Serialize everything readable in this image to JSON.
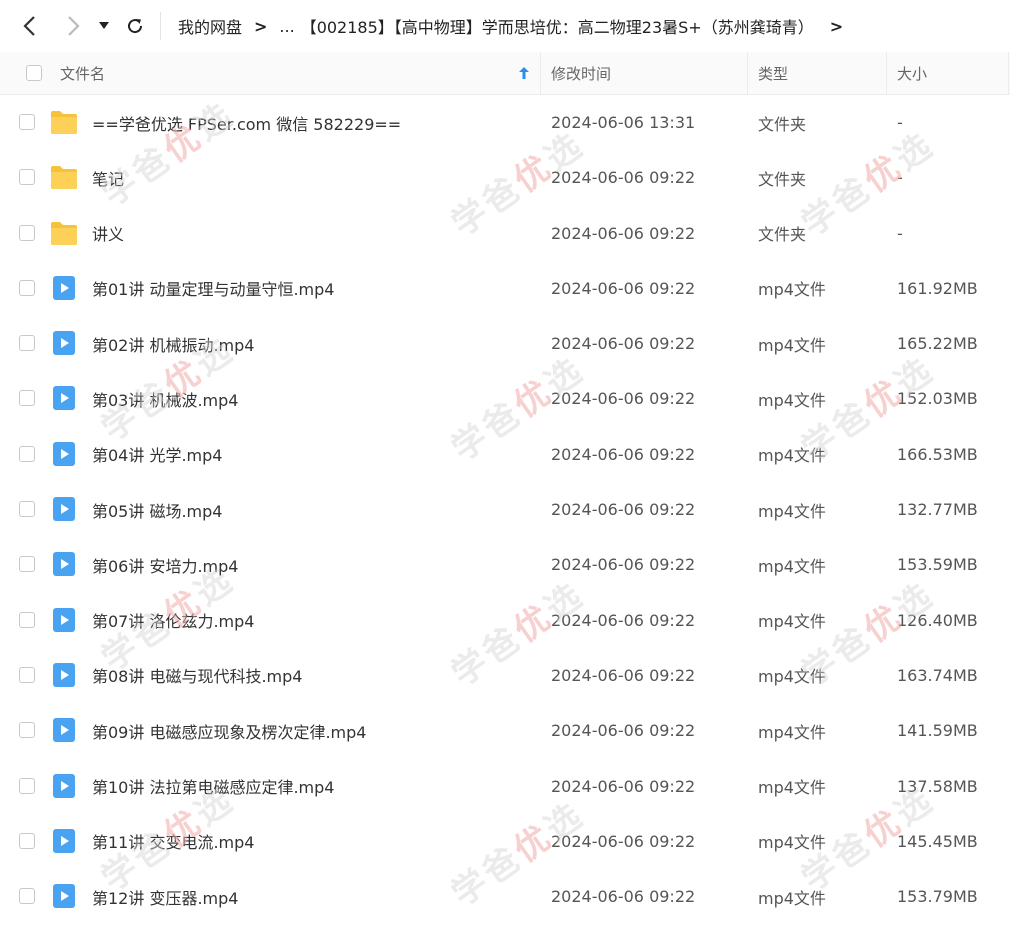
{
  "toolbar": {
    "back_icon": "chevron-left-icon",
    "forward_icon": "chevron-right-icon",
    "dropdown_icon": "caret-down-icon",
    "refresh_icon": "refresh-icon"
  },
  "breadcrumb": {
    "root": "我的网盘",
    "ellipsis": "...",
    "current": "【002185】【高中物理】学而思培优：高二物理23暑S+（苏州龚琦青）",
    "separator": ">"
  },
  "columns": {
    "name": "文件名",
    "modified": "修改时间",
    "type": "类型",
    "size": "大小"
  },
  "colors": {
    "folder": "#f7c23b",
    "video": "#4aa3f0",
    "sort_arrow": "#2b8fe8"
  },
  "watermark": {
    "text_a": "学爸",
    "text_b": "优",
    "text_c": "选"
  },
  "files": [
    {
      "name": "==学爸优选 FPSer.com 微信 582229==",
      "modified": "2024-06-06 13:31",
      "type": "文件夹",
      "size": "-",
      "icon": "folder-icon"
    },
    {
      "name": "笔记",
      "modified": "2024-06-06 09:22",
      "type": "文件夹",
      "size": "-",
      "icon": "folder-icon"
    },
    {
      "name": "讲义",
      "modified": "2024-06-06 09:22",
      "type": "文件夹",
      "size": "-",
      "icon": "folder-icon"
    },
    {
      "name": "第01讲 动量定理与动量守恒.mp4",
      "modified": "2024-06-06 09:22",
      "type": "mp4文件",
      "size": "161.92MB",
      "icon": "video-file-icon"
    },
    {
      "name": "第02讲 机械振动.mp4",
      "modified": "2024-06-06 09:22",
      "type": "mp4文件",
      "size": "165.22MB",
      "icon": "video-file-icon"
    },
    {
      "name": "第03讲 机械波.mp4",
      "modified": "2024-06-06 09:22",
      "type": "mp4文件",
      "size": "152.03MB",
      "icon": "video-file-icon"
    },
    {
      "name": "第04讲 光学.mp4",
      "modified": "2024-06-06 09:22",
      "type": "mp4文件",
      "size": "166.53MB",
      "icon": "video-file-icon"
    },
    {
      "name": "第05讲 磁场.mp4",
      "modified": "2024-06-06 09:22",
      "type": "mp4文件",
      "size": "132.77MB",
      "icon": "video-file-icon"
    },
    {
      "name": "第06讲 安培力.mp4",
      "modified": "2024-06-06 09:22",
      "type": "mp4文件",
      "size": "153.59MB",
      "icon": "video-file-icon"
    },
    {
      "name": "第07讲 洛伦兹力.mp4",
      "modified": "2024-06-06 09:22",
      "type": "mp4文件",
      "size": "126.40MB",
      "icon": "video-file-icon"
    },
    {
      "name": "第08讲 电磁与现代科技.mp4",
      "modified": "2024-06-06 09:22",
      "type": "mp4文件",
      "size": "163.74MB",
      "icon": "video-file-icon"
    },
    {
      "name": "第09讲 电磁感应现象及楞次定律.mp4",
      "modified": "2024-06-06 09:22",
      "type": "mp4文件",
      "size": "141.59MB",
      "icon": "video-file-icon"
    },
    {
      "name": "第10讲 法拉第电磁感应定律.mp4",
      "modified": "2024-06-06 09:22",
      "type": "mp4文件",
      "size": "137.58MB",
      "icon": "video-file-icon"
    },
    {
      "name": "第11讲 交变电流.mp4",
      "modified": "2024-06-06 09:22",
      "type": "mp4文件",
      "size": "145.45MB",
      "icon": "video-file-icon"
    },
    {
      "name": "第12讲 变压器.mp4",
      "modified": "2024-06-06 09:22",
      "type": "mp4文件",
      "size": "153.79MB",
      "icon": "video-file-icon"
    }
  ]
}
